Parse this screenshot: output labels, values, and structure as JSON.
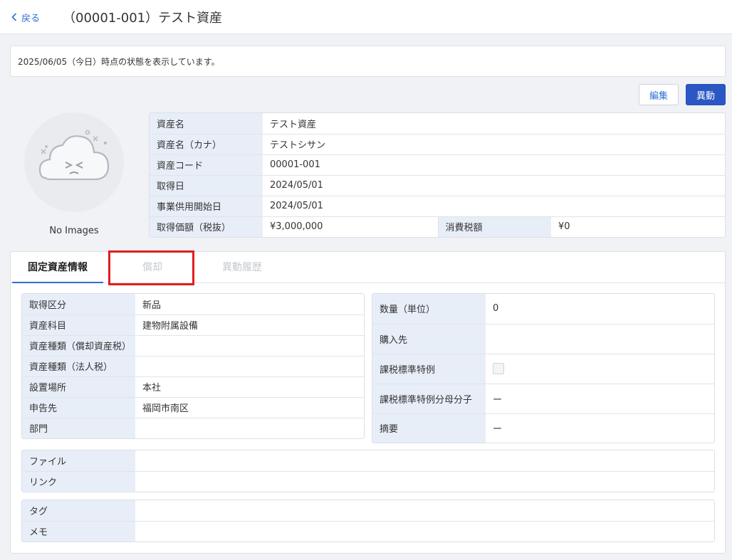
{
  "header": {
    "back_label": "戻る",
    "title": "（00001-001）テスト資産"
  },
  "notice": "2025/06/05（今日）時点の状態を表示しています。",
  "actions": {
    "edit": "編集",
    "transfer": "異動"
  },
  "image": {
    "caption": "No Images"
  },
  "summary": {
    "asset_name_label": "資産名",
    "asset_name": "テスト資産",
    "asset_kana_label": "資産名（カナ）",
    "asset_kana": "テストシサン",
    "asset_code_label": "資産コード",
    "asset_code": "00001-001",
    "acquired_label": "取得日",
    "acquired": "2024/05/01",
    "start_label": "事業供用開始日",
    "start": "2024/05/01",
    "price_label": "取得価額（税抜）",
    "price": "¥3,000,000",
    "tax_label": "消費税額",
    "tax": "¥0"
  },
  "tabs": {
    "fixed": "固定資産情報",
    "depreciation": "償却",
    "history": "異動履歴"
  },
  "left_details": [
    {
      "label": "取得区分",
      "value": "新品"
    },
    {
      "label": "資産科目",
      "value": "建物附属設備"
    },
    {
      "label": "資産種類（償却資産税）",
      "value": ""
    },
    {
      "label": "資産種類（法人税）",
      "value": ""
    },
    {
      "label": "設置場所",
      "value": "本社"
    },
    {
      "label": "申告先",
      "value": "福岡市南区"
    },
    {
      "label": "部門",
      "value": ""
    }
  ],
  "right_details": [
    {
      "label": "数量（単位）",
      "value": "0"
    },
    {
      "label": "購入先",
      "value": ""
    },
    {
      "label": "課税標準特例",
      "value": ""
    },
    {
      "label": "課税標準特例分母分子",
      "value": "ー"
    },
    {
      "label": "摘要",
      "value": "ー"
    }
  ],
  "files": [
    {
      "label": "ファイル",
      "value": ""
    },
    {
      "label": "リンク",
      "value": ""
    }
  ],
  "tags": [
    {
      "label": "タグ",
      "value": ""
    },
    {
      "label": "メモ",
      "value": ""
    }
  ]
}
